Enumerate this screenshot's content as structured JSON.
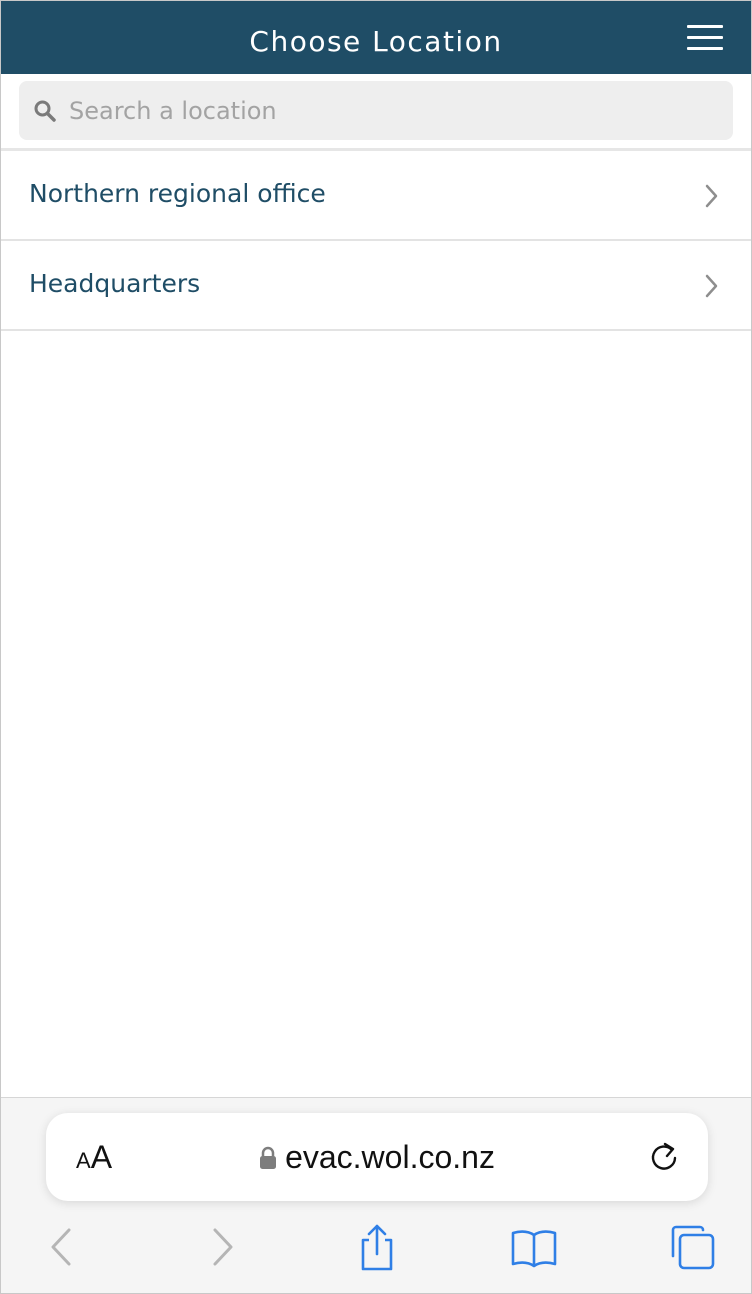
{
  "header": {
    "title": "Choose Location",
    "menu_icon": "hamburger-menu-icon"
  },
  "search": {
    "placeholder": "Search a location",
    "value": "",
    "icon": "search-icon"
  },
  "locations": [
    {
      "label": "Northern regional office",
      "icon": "chevron-right-icon"
    },
    {
      "label": "Headquarters",
      "icon": "chevron-right-icon"
    }
  ],
  "browser": {
    "text_size_small": "A",
    "text_size_large": "A",
    "url": "evac.wol.co.nz",
    "toolbar": [
      "back-icon",
      "forward-icon",
      "share-icon",
      "bookmarks-icon",
      "tabs-icon"
    ]
  },
  "colors": {
    "header_bg": "#1f4d66",
    "list_text": "#1f4d66",
    "placeholder": "#a3a3a3",
    "toolbar_active": "#2f7fe6",
    "toolbar_disabled": "#b5b5b5"
  }
}
